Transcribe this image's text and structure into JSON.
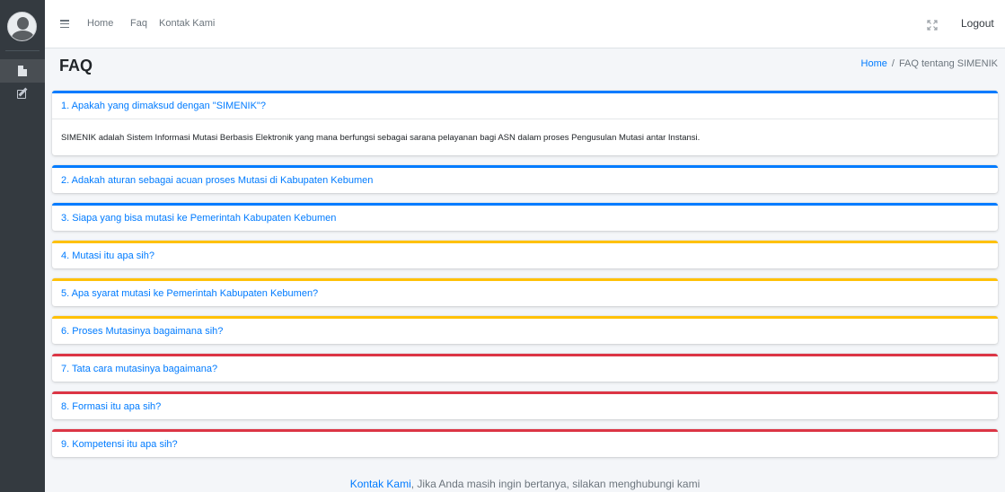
{
  "navbar": {
    "links": [
      "Home",
      "Faq",
      "Kontak Kami"
    ],
    "logout": "Logout"
  },
  "header": {
    "title": "FAQ",
    "breadcrumb": {
      "home": "Home",
      "separator": "/",
      "current": "FAQ tentang SIMENIK"
    }
  },
  "faq": [
    {
      "question": "1. Apakah yang dimaksud dengan \"SIMENIK\"?",
      "answer": "SIMENIK adalah Sistem Informasi Mutasi Berbasis Elektronik yang mana berfungsi sebagai sarana pelayanan bagi ASN dalam proses Pengusulan Mutasi antar Instansi.",
      "expanded": true,
      "accent": "#007bff"
    },
    {
      "question": "2. Adakah aturan sebagai acuan proses Mutasi di Kabupaten Kebumen",
      "accent": "#007bff"
    },
    {
      "question": "3. Siapa yang bisa mutasi ke Pemerintah Kabupaten Kebumen",
      "accent": "#007bff"
    },
    {
      "question": "4. Mutasi itu apa sih?",
      "accent": "#ffc107"
    },
    {
      "question": "5. Apa syarat mutasi ke Pemerintah Kabupaten Kebumen?",
      "accent": "#ffc107"
    },
    {
      "question": "6. Proses Mutasinya bagaimana sih?",
      "accent": "#ffc107"
    },
    {
      "question": "7. Tata cara mutasinya bagaimana?",
      "accent": "#dc3545"
    },
    {
      "question": "8. Formasi itu apa sih?",
      "accent": "#dc3545"
    },
    {
      "question": "9. Kompetensi itu apa sih?",
      "accent": "#dc3545"
    }
  ],
  "footer": {
    "link": "Kontak Kami",
    "text": ", Jika Anda masih ingin bertanya, silakan menghubungi kami"
  },
  "icons": [
    "avatar",
    "file-icon",
    "edit-icon",
    "hamburger-icon",
    "expand-icon"
  ],
  "colors": {
    "primary": "#007bff",
    "warning": "#ffc107",
    "danger": "#dc3545",
    "sidebar": "#343a40"
  }
}
